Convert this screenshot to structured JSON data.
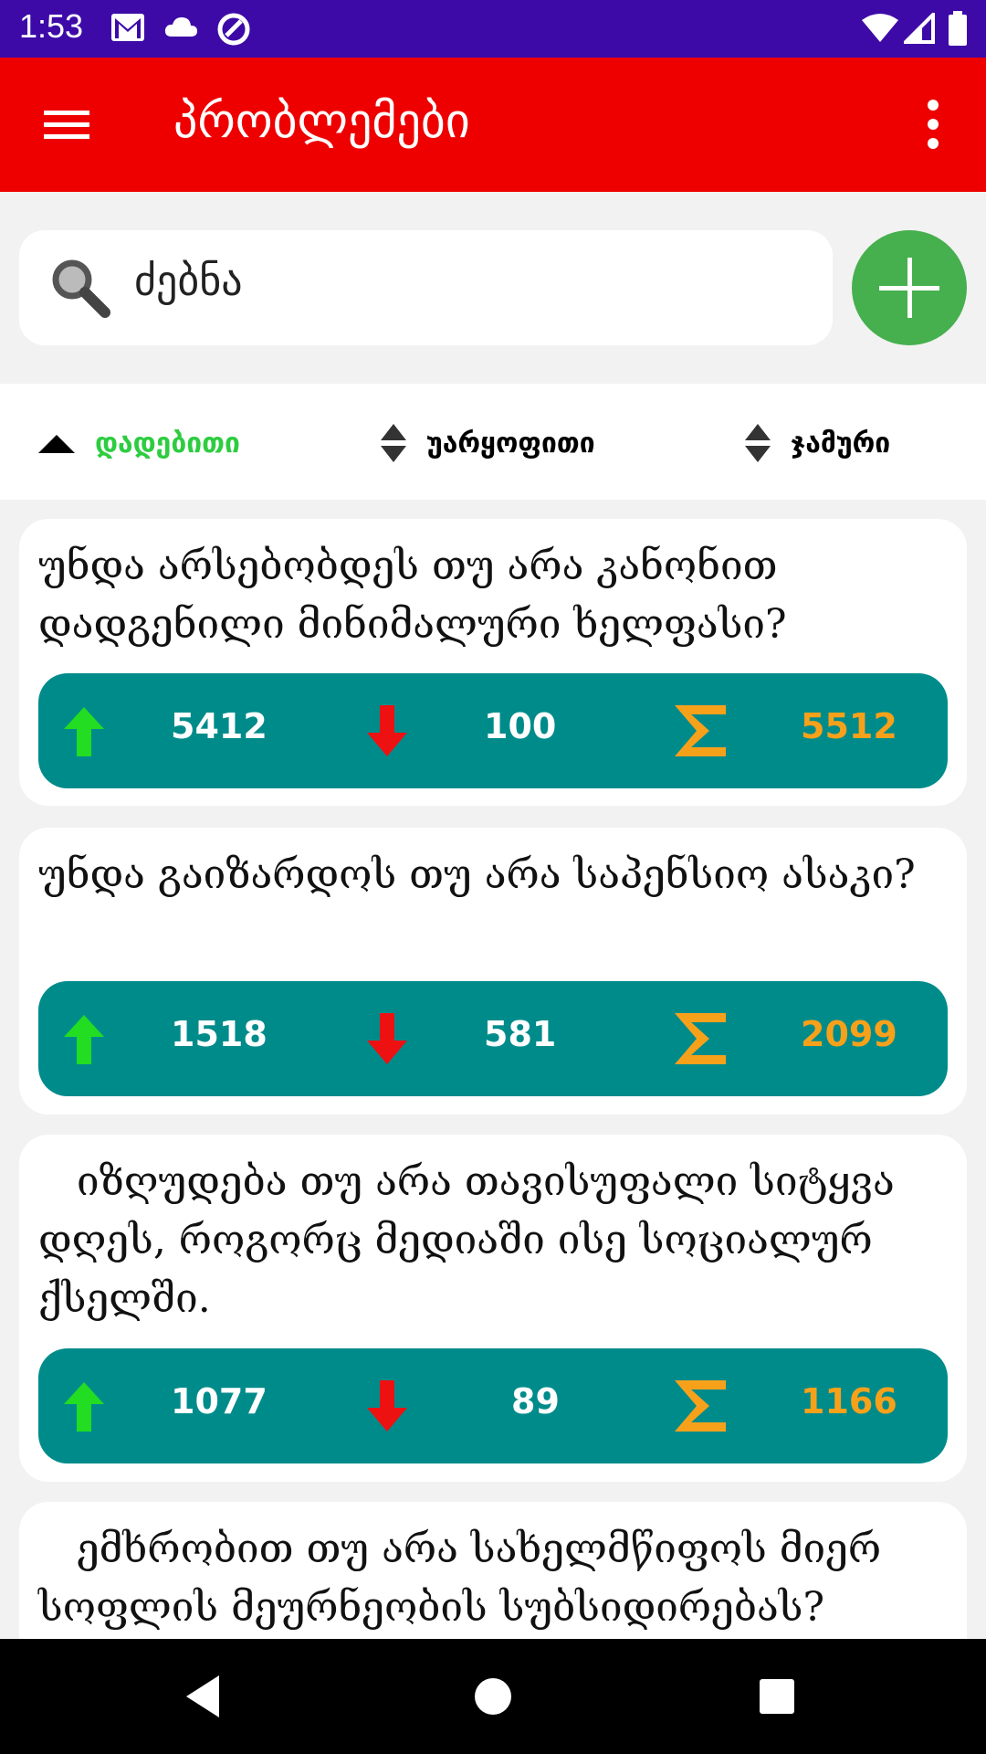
{
  "status_bar": {
    "time": "1:53",
    "left_icons": [
      "gmail-icon",
      "cloud-icon",
      "sync-icon"
    ],
    "right_icons": [
      "wifi-icon",
      "signal-icon",
      "battery-icon"
    ]
  },
  "app_bar": {
    "title": "პრობლემები",
    "color": "#ee0000"
  },
  "search": {
    "value": "ძებნა"
  },
  "sort": {
    "items": [
      {
        "label": "დადებითი",
        "state": "ascending"
      },
      {
        "label": "უარყოფითი",
        "state": "none"
      },
      {
        "label": "ჯამური",
        "state": "none"
      }
    ]
  },
  "problems": [
    {
      "title": "უნდა არსებობდეს თუ არა კანონით დადგენილი მინიმალური ხელფასი?",
      "up": "5412",
      "down": "100",
      "total": "5512"
    },
    {
      "title": "უნდა გაიზარდოს თუ არა საპენსიო ასაკი?",
      "up": "1518",
      "down": "581",
      "total": "2099"
    },
    {
      "title": "   იზღუდება თუ არა თავისუფალი სიტყვა დღეს, როგორც მედიაში ისე სოციალურ ქსელში.",
      "up": "1077",
      "down": "89",
      "total": "1166"
    },
    {
      "title": "   ემხრობით თუ არა სახელმწიფოს მიერ სოფლის მეურნეობის სუბსიდირებას?"
    }
  ],
  "colors": {
    "status_bar": "#3d0aa8",
    "accent_green": "#46b04e",
    "stats_teal": "#008b8b",
    "total_orange": "#f7a11a"
  }
}
